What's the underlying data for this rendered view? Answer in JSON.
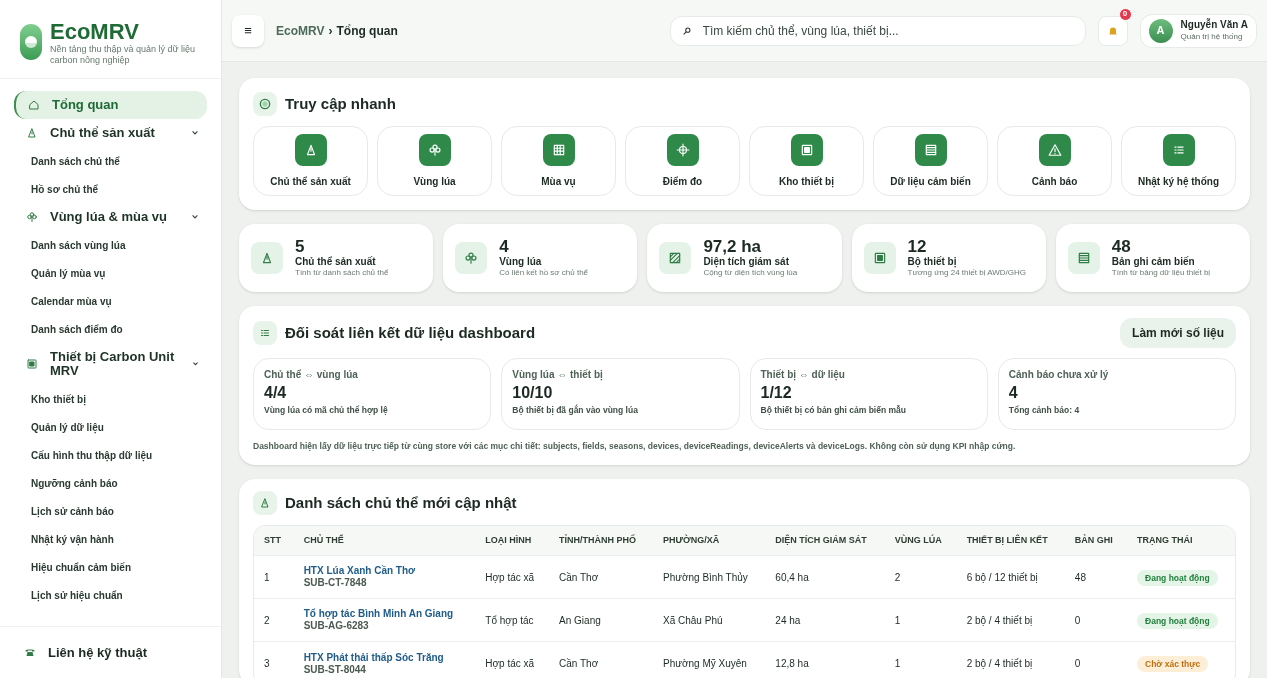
{
  "brand": {
    "name": "EcoMRV",
    "tagline": "Nền tảng thu thập và quản lý dữ liệu carbon nông nghiệp"
  },
  "sidebar": {
    "items": [
      {
        "kind": "link",
        "label": "Tổng quan",
        "selected": true
      },
      {
        "kind": "group",
        "label": "Chủ thể sản xuất",
        "expanded": true,
        "children": [
          {
            "label": "Danh sách chủ thể"
          },
          {
            "label": "Hồ sơ chủ thể"
          }
        ]
      },
      {
        "kind": "group",
        "label": "Vùng lúa & mùa vụ",
        "expanded": true,
        "children": [
          {
            "label": "Danh sách vùng lúa"
          },
          {
            "label": "Quản lý mùa vụ"
          },
          {
            "label": "Calendar mùa vụ"
          },
          {
            "label": "Danh sách điểm đo"
          }
        ]
      },
      {
        "kind": "group",
        "label": "Thiết bị Carbon Unit MRV",
        "expanded": true,
        "children": [
          {
            "label": "Kho thiết bị"
          },
          {
            "label": "Quản lý dữ liệu"
          },
          {
            "label": "Cấu hình thu thập dữ liệu"
          },
          {
            "label": "Ngưỡng cảnh báo"
          },
          {
            "label": "Lịch sử cảnh báo"
          },
          {
            "label": "Nhật ký vận hành"
          },
          {
            "label": "Hiệu chuẩn cảm biến"
          },
          {
            "label": "Lịch sử hiệu chuẩn"
          }
        ]
      }
    ],
    "footer": {
      "label": "Liên hệ kỹ thuật"
    }
  },
  "header": {
    "menu_glyph": "≡",
    "breadcrumb": [
      "EcoMRV",
      "Tổng quan"
    ],
    "breadcrumb_sep": "›",
    "search": {
      "placeholder": "Tìm kiếm chủ thể, vùng lúa, thiết bị..."
    },
    "notifications": "0",
    "user": {
      "initial": "A",
      "name": "Nguyễn Văn A",
      "role": "Quản trị hệ thống"
    }
  },
  "quick_access": {
    "title": "Truy cập nhanh",
    "items": [
      {
        "label": "Chủ thể sản xuất"
      },
      {
        "label": "Vùng lúa"
      },
      {
        "label": "Mùa vụ"
      },
      {
        "label": "Điểm đo"
      },
      {
        "label": "Kho thiết bị"
      },
      {
        "label": "Dữ liệu cảm biến"
      },
      {
        "label": "Cảnh báo"
      },
      {
        "label": "Nhật ký hệ thống"
      }
    ]
  },
  "stats": [
    {
      "value": "5",
      "label": "Chủ thể sản xuất",
      "sub": "Tính từ danh sách chủ thể"
    },
    {
      "value": "4",
      "label": "Vùng lúa",
      "sub": "Có liên kết hồ sơ chủ thể"
    },
    {
      "value": "97,2 ha",
      "label": "Diện tích giám sát",
      "sub": "Cộng từ diện tích vùng lúa"
    },
    {
      "value": "12",
      "label": "Bộ thiết bị",
      "sub": "Tương ứng 24 thiết bị AWD/GHG"
    },
    {
      "value": "48",
      "label": "Bản ghi cảm biến",
      "sub": "Tính từ bảng dữ liệu thiết bị"
    }
  ],
  "reconcile": {
    "title": "Đối soát liên kết dữ liệu dashboard",
    "button": "Làm mới số liệu",
    "items": [
      {
        "title": "Chủ thể ⇔ vùng lúa",
        "value": "4/4",
        "sub": "Vùng lúa có mã chủ thể hợp lệ"
      },
      {
        "title": "Vùng lúa ⇔ thiết bị",
        "value": "10/10",
        "sub": "Bộ thiết bị đã gắn vào vùng lúa"
      },
      {
        "title": "Thiết bị ⇔ dữ liệu",
        "value": "1/12",
        "sub": "Bộ thiết bị có bản ghi cảm biến mẫu"
      },
      {
        "title": "Cảnh báo chưa xử lý",
        "value": "4",
        "sub": "Tổng cảnh báo: 4"
      }
    ],
    "note": "Dashboard hiện lấy dữ liệu trực tiếp từ cùng store với các mục chi tiết: subjects, fields, seasons, devices, deviceReadings, deviceAlerts và deviceLogs. Không còn sử dụng KPI nhập cứng."
  },
  "subjects": {
    "title": "Danh sách chủ thể mới cập nhật",
    "columns": [
      "STT",
      "CHỦ THỂ",
      "LOẠI HÌNH",
      "TỈNH/THÀNH PHỐ",
      "PHƯỜNG/XÃ",
      "DIỆN TÍCH GIÁM SÁT",
      "VÙNG LÚA",
      "THIẾT BỊ LIÊN KẾT",
      "BẢN GHI",
      "TRẠNG THÁI"
    ],
    "rows": [
      {
        "stt": "1",
        "name": "HTX Lúa Xanh Cần Thơ",
        "code": "SUB-CT-7848",
        "type": "Hợp tác xã",
        "province": "Cần Thơ",
        "ward": "Phường Bình Thủy",
        "area": "60,4 ha",
        "fields": "2",
        "devices": "6 bộ / 12 thiết bị",
        "records": "48",
        "status": {
          "kind": "active",
          "label": "Đang hoạt động"
        }
      },
      {
        "stt": "2",
        "name": "Tổ hợp tác Bình Minh An Giang",
        "code": "SUB-AG-6283",
        "type": "Tổ hợp tác",
        "province": "An Giang",
        "ward": "Xã Châu Phú",
        "area": "24 ha",
        "fields": "1",
        "devices": "2 bộ / 4 thiết bị",
        "records": "0",
        "status": {
          "kind": "active",
          "label": "Đang hoạt động"
        }
      },
      {
        "stt": "3",
        "name": "HTX Phát thải thấp Sóc Trăng",
        "code": "SUB-ST-8044",
        "type": "Hợp tác xã",
        "province": "Cần Thơ",
        "ward": "Phường Mỹ Xuyên",
        "area": "12,8 ha",
        "fields": "1",
        "devices": "2 bộ / 4 thiết bị",
        "records": "0",
        "status": {
          "kind": "pending",
          "label": "Chờ xác thực"
        }
      }
    ]
  }
}
